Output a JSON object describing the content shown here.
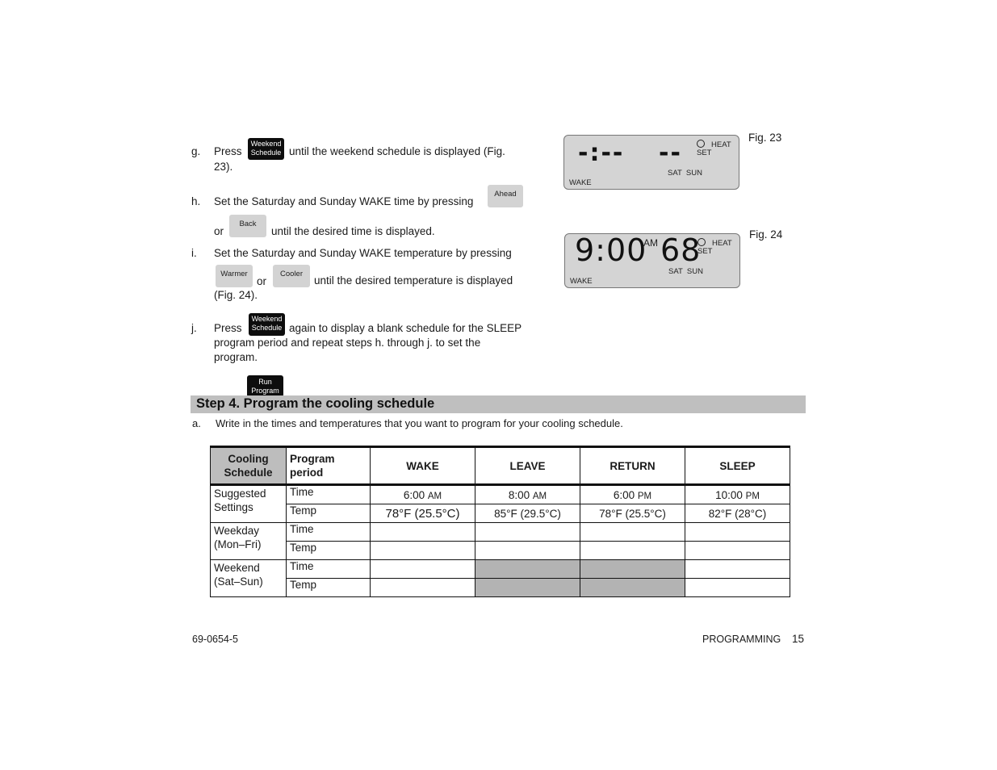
{
  "steps": {
    "g": {
      "label": "g.",
      "before": "Press",
      "key": {
        "line1": "Weekend",
        "line2": "Schedule"
      },
      "after_line1": "until the weekend schedule is displayed (Fig.",
      "after_line2": "23)."
    },
    "h": {
      "label": "h.",
      "line1": "Set the Saturday and Sunday WAKE time by pressing",
      "key1": "Ahead",
      "or": "or",
      "key2": "Back",
      "line2_after": "until the desired time is displayed."
    },
    "i": {
      "label": "i.",
      "line1": "Set the Saturday and Sunday WAKE temperature by pressing",
      "key1": "Warmer",
      "or": "or",
      "key2": "Cooler",
      "line2_after": "until the desired temperature is displayed",
      "line3": "(Fig. 24)."
    },
    "j": {
      "label": "j.",
      "before": "Press",
      "key": {
        "line1": "Weekend",
        "line2": "Schedule"
      },
      "after_line1": "again to display a blank schedule for the SLEEP",
      "line2": "program period and repeat steps h. through j. to set the",
      "line3": "program."
    },
    "run_key": {
      "line1": "Run",
      "line2": "Program"
    }
  },
  "figures": {
    "fig23": {
      "caption": "Fig. 23",
      "time": "-:--",
      "temp": "--",
      "heat": "HEAT",
      "set": "SET",
      "days": "SAT  SUN",
      "period": "WAKE"
    },
    "fig24": {
      "caption": "Fig. 24",
      "time": "9:00",
      "ampm": "AM",
      "temp": "68",
      "heat": "HEAT",
      "set": "SET",
      "days": "SAT  SUN",
      "period": "WAKE"
    }
  },
  "section": {
    "title": "Step 4. Program the cooling schedule",
    "item_a_label": "a.",
    "item_a_text": "Write in the times and temperatures that you want to program for your cooling schedule."
  },
  "table": {
    "corner": {
      "line1": "Cooling",
      "line2": "Schedule"
    },
    "period_header": {
      "line1": "Program",
      "line2": "period"
    },
    "columns": [
      "WAKE",
      "LEAVE",
      "RETURN",
      "SLEEP"
    ],
    "groups": [
      {
        "name_line1": "Suggested",
        "name_line2": "Settings",
        "rows": [
          {
            "kind": "Time",
            "values": [
              {
                "num": "6:00",
                "suffix": "AM"
              },
              {
                "num": "8:00",
                "suffix": "AM"
              },
              {
                "num": "6:00",
                "suffix": "PM"
              },
              {
                "num": "10:00",
                "suffix": "PM"
              }
            ]
          },
          {
            "kind": "Temp",
            "values": [
              {
                "num": "78°F (25.5°C)",
                "suffix": ""
              },
              {
                "num": "85°F (29.5°C)",
                "suffix": ""
              },
              {
                "num": "78°F (25.5°C)",
                "suffix": ""
              },
              {
                "num": "82°F (28°C)",
                "suffix": ""
              }
            ]
          }
        ]
      },
      {
        "name_line1": "Weekday",
        "name_line2": "(Mon–Fri)",
        "rows": [
          {
            "kind": "Time",
            "values": [
              {
                "num": "",
                "suffix": ""
              },
              {
                "num": "",
                "suffix": ""
              },
              {
                "num": "",
                "suffix": ""
              },
              {
                "num": "",
                "suffix": ""
              }
            ]
          },
          {
            "kind": "Temp",
            "values": [
              {
                "num": "",
                "suffix": ""
              },
              {
                "num": "",
                "suffix": ""
              },
              {
                "num": "",
                "suffix": ""
              },
              {
                "num": "",
                "suffix": ""
              }
            ]
          }
        ]
      },
      {
        "name_line1": "Weekend",
        "name_line2": "(Sat–Sun)",
        "rows": [
          {
            "kind": "Time",
            "values": [
              {
                "num": "",
                "suffix": ""
              },
              {
                "num": "",
                "suffix": ""
              },
              {
                "num": "",
                "suffix": ""
              },
              {
                "num": "",
                "suffix": ""
              }
            ]
          },
          {
            "kind": "Temp",
            "values": [
              {
                "num": "",
                "suffix": ""
              },
              {
                "num": "",
                "suffix": ""
              },
              {
                "num": "",
                "suffix": ""
              },
              {
                "num": "",
                "suffix": ""
              }
            ]
          }
        ]
      }
    ]
  },
  "footer": {
    "doc_number": "69-0654-5",
    "section": "PROGRAMMING",
    "page": "15"
  }
}
